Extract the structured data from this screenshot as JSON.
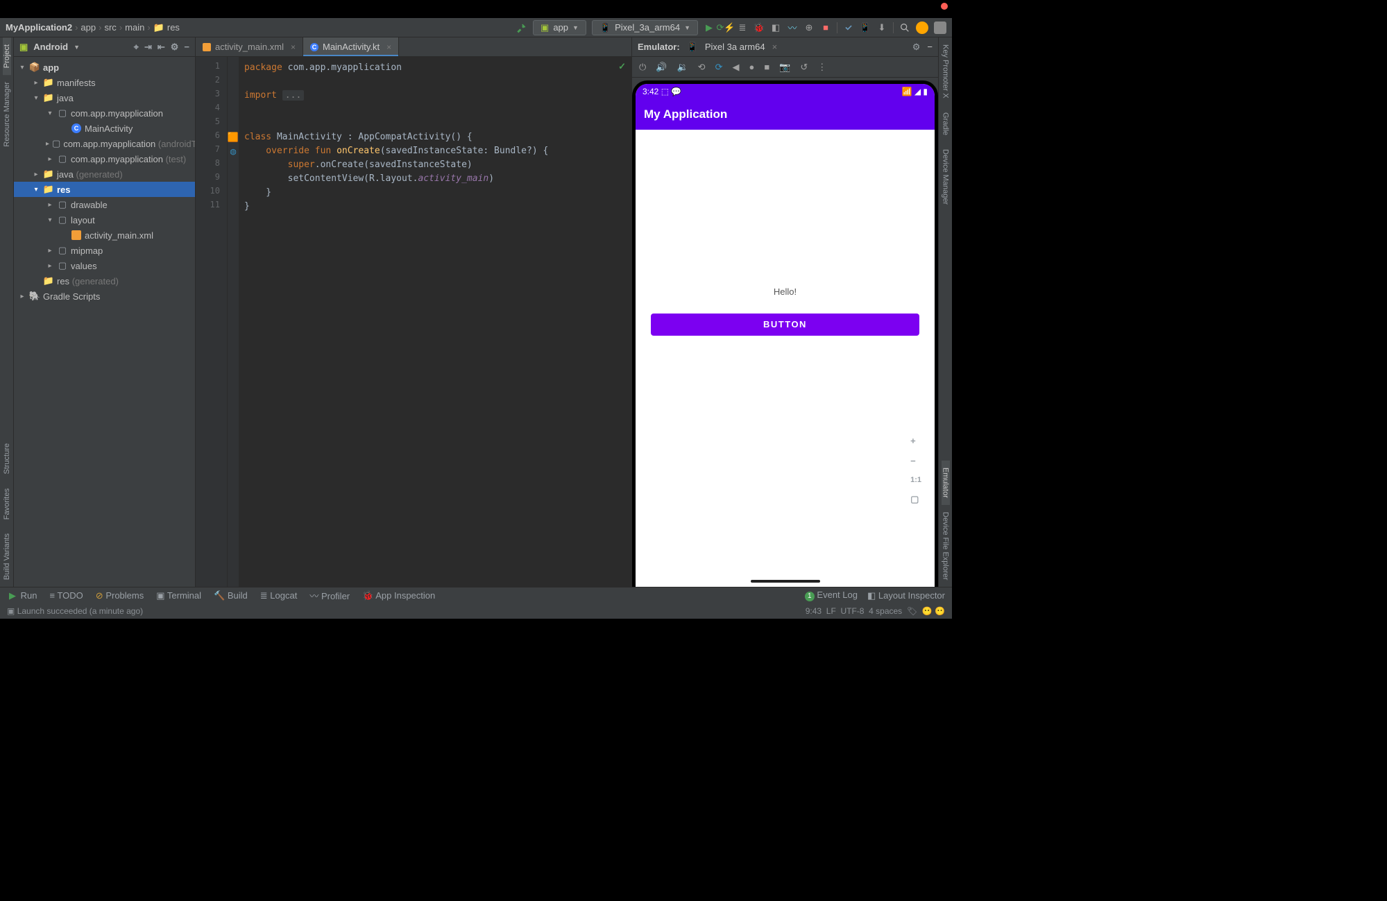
{
  "breadcrumb": {
    "items": [
      "MyApplication2",
      "app",
      "src",
      "main",
      "res"
    ]
  },
  "runConfig": {
    "app": "app",
    "device": "Pixel_3a_arm64"
  },
  "projectPanel": {
    "title": "Android",
    "tree": {
      "app": "app",
      "manifests": "manifests",
      "java": "java",
      "pkg": "com.app.myapplication",
      "mainActivity": "MainActivity",
      "pkgAndroidTest": "com.app.myapplication",
      "pkgAndroidTestSuffix": "(androidTest)",
      "pkgTest": "com.app.myapplication",
      "pkgTestSuffix": "(test)",
      "javaGen": "java",
      "javaGenSuffix": "(generated)",
      "res": "res",
      "drawable": "drawable",
      "layout": "layout",
      "activityMainXml": "activity_main.xml",
      "mipmap": "mipmap",
      "values": "values",
      "resGen": "res",
      "resGenSuffix": "(generated)",
      "gradleScripts": "Gradle Scripts"
    }
  },
  "editor": {
    "tabs": {
      "xml": "activity_main.xml",
      "kt": "MainActivity.kt"
    },
    "gutter": [
      "1",
      "2",
      "3",
      "4",
      "5",
      "6",
      "7",
      "8",
      "9",
      "10",
      "11"
    ],
    "code": {
      "l1a": "package",
      "l1b": " com.app.myapplication",
      "l3a": "import",
      "l3b": "...",
      "l6a": "class",
      "l6b": " MainActivity : AppCompatActivity() {",
      "l7a": "    override fun ",
      "l7b": "onCreate",
      "l7c": "(savedInstanceState: Bundle?) {",
      "l8a": "        super",
      "l8b": ".onCreate(savedInstanceState)",
      "l9a": "        setContentView(R.layout.",
      "l9b": "activity_main",
      "l9c": ")",
      "l10": "    }",
      "l11": "}"
    }
  },
  "emulator": {
    "label": "Emulator:",
    "device": "Pixel 3a arm64",
    "statusTime": "3:42",
    "appTitle": "My Application",
    "hello": "Hello!",
    "buttonLabel": "BUTTON"
  },
  "rightStrip": [
    "Key Promoter X",
    "Gradle",
    "Device Manager",
    "Emulator",
    "Device File Explorer"
  ],
  "leftStrip": [
    "Project",
    "Resource Manager",
    "Structure",
    "Favorites",
    "Build Variants"
  ],
  "footer": {
    "run": "Run",
    "todo": "TODO",
    "problems": "Problems",
    "terminal": "Terminal",
    "build": "Build",
    "logcat": "Logcat",
    "profiler": "Profiler",
    "appInspection": "App Inspection",
    "eventLog": "Event Log",
    "layoutInspector": "Layout Inspector"
  },
  "status": {
    "msg": "Launch succeeded (a minute ago)",
    "clock": "9:43",
    "lf": "LF",
    "enc": "UTF-8",
    "indent": "4 spaces"
  },
  "emZoom": {
    "plus": "+",
    "minus": "−",
    "oneToOne": "1:1"
  }
}
